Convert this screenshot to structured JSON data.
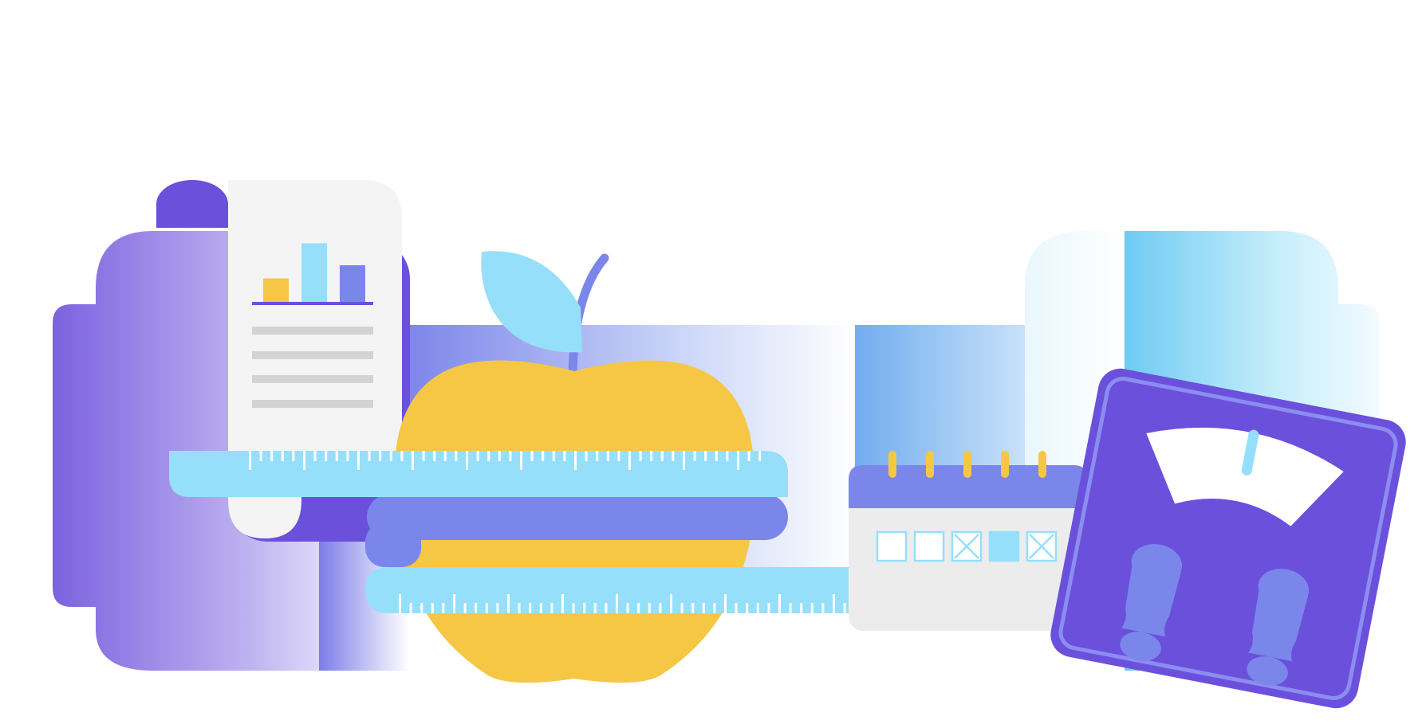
{
  "illustration": {
    "elements": [
      "report-document",
      "apple",
      "measuring-tapes",
      "calendar",
      "bathroom-scale"
    ],
    "report_chart_bars": [
      0.32,
      0.8,
      0.5
    ],
    "calendar_days": [
      "empty",
      "empty",
      "crossed",
      "filled",
      "crossed"
    ],
    "calendar_rings": 5,
    "scale_needle": "right of center"
  },
  "colors": {
    "purple": "#6b50dc",
    "periwinkle": "#7b86ea",
    "light_blue": "#96dffa",
    "sky_blue": "#6ec8f2",
    "apple_yellow": "#f6c745",
    "paper": "#f4f4f4",
    "line_grey": "#d3d3d3",
    "calendar_body": "#ececec",
    "white": "#ffffff"
  }
}
